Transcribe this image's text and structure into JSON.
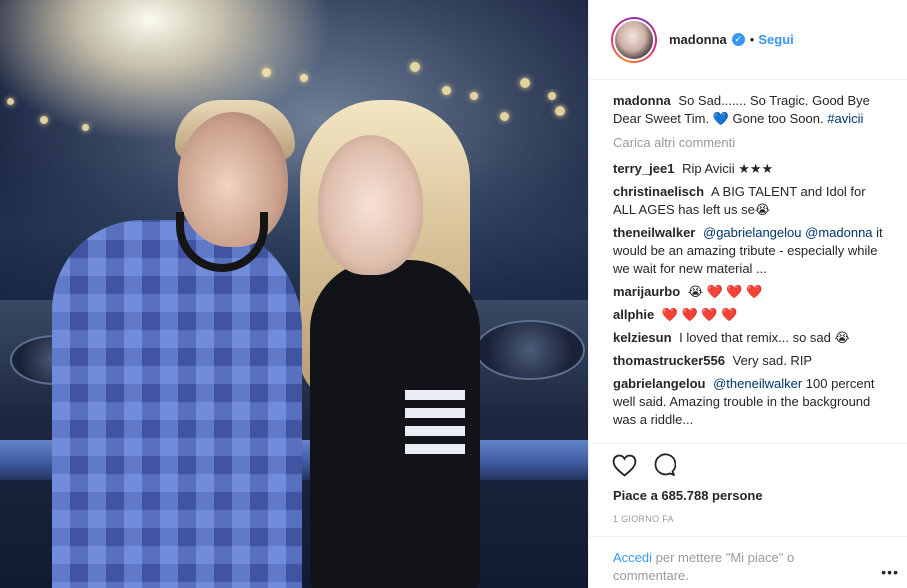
{
  "post": {
    "username": "madonna",
    "dot": "•",
    "follow_label": "Segui",
    "verified_icon": "verified-badge-icon"
  },
  "caption": {
    "author": "madonna",
    "text_before_emoji": "So Sad....... So Tragic. Good Bye Dear Sweet Tim.",
    "emoji": "💙",
    "text_after_emoji": "Gone too Soon.",
    "hashtag": "#avicii"
  },
  "load_more_label": "Carica altri commenti",
  "comments": [
    {
      "author": "terry_jee1",
      "text": "Rip Avicii ★★★"
    },
    {
      "author": "christinaelisch",
      "text": "A BIG TALENT and Idol for ALL AGES has left us se😭"
    },
    {
      "author": "theneilwalker",
      "mention1": "@gabrielangelou",
      "mention2": "@madonna",
      "text": "it would be an amazing tribute - especially while we wait for new material ..."
    },
    {
      "author": "marijaurbo",
      "text": "😭 ❤️ ❤️ ❤️"
    },
    {
      "author": "allphie",
      "text": "❤️ ❤️ ❤️ ❤️"
    },
    {
      "author": "kelziesun",
      "text": "I loved that remix... so sad 😭"
    },
    {
      "author": "thomastrucker556",
      "text": "Very sad. RIP"
    },
    {
      "author": "gabrielangelou",
      "mention1": "@theneilwalker",
      "text": "100 percent well said. Amazing trouble in the background was a riddle..."
    }
  ],
  "likes_label": "Piace a 685.788 persone",
  "time_ago": "1 GIORNO FA",
  "login": {
    "link": "Accedi",
    "rest": "per mettere \"Mi piace\" o commentare."
  },
  "more_label": "•••",
  "icons": {
    "like": "heart-outline-icon",
    "comment": "speech-bubble-icon"
  },
  "colors": {
    "link_blue": "#3897f0",
    "mention_blue": "#003569",
    "muted_gray": "#999999",
    "text": "#262626"
  }
}
